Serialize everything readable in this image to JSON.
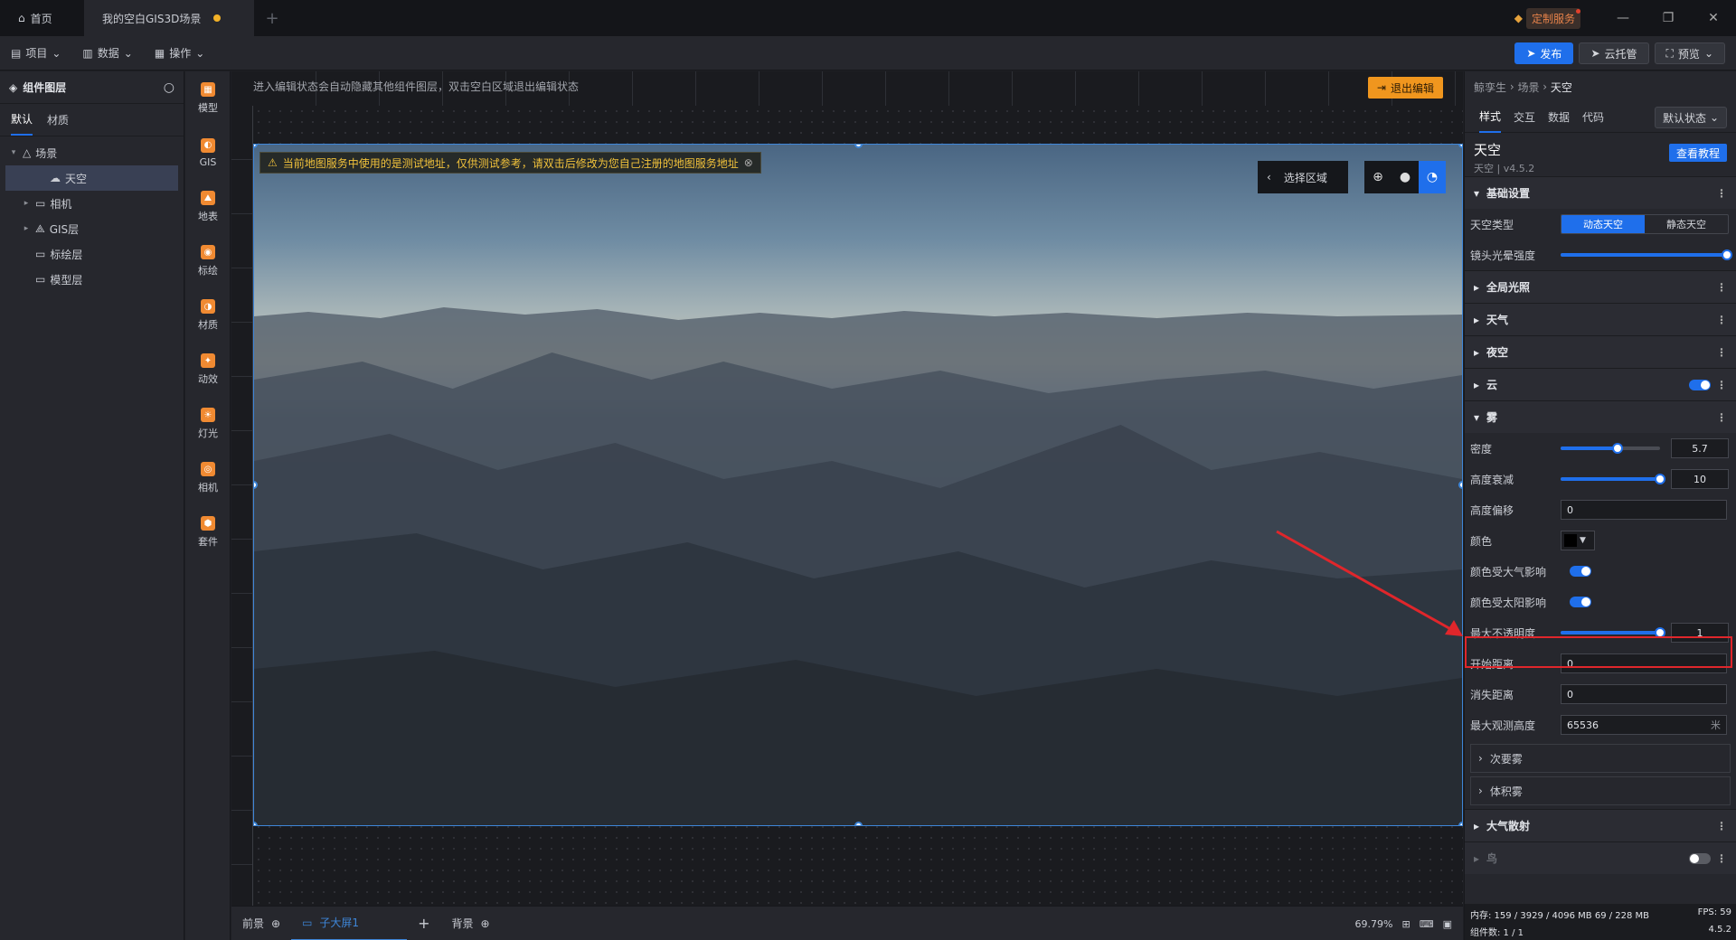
{
  "tabs": {
    "home": "首页",
    "scene_tab": "我的空白GIS3D场景"
  },
  "custom_service": "定制服务",
  "menu": {
    "project": "项目",
    "data": "数据",
    "operate": "操作"
  },
  "actions": {
    "publish": "发布",
    "cloud": "云托管",
    "preview": "预览"
  },
  "left": {
    "title": "组件图层",
    "tab_default": "默认",
    "tab_material": "材质",
    "tree": [
      {
        "label": "场景",
        "caret": "▾",
        "icon": "scene-icon",
        "indent": 0
      },
      {
        "label": "天空",
        "caret": "",
        "icon": "sky-icon",
        "indent": 1,
        "selected": true
      },
      {
        "label": "相机",
        "caret": "▸",
        "icon": "folder-icon",
        "indent": 1
      },
      {
        "label": "GIS层",
        "caret": "▸",
        "icon": "gis-icon",
        "indent": 1
      },
      {
        "label": "标绘层",
        "caret": "",
        "icon": "folder-icon",
        "indent": 1
      },
      {
        "label": "模型层",
        "caret": "",
        "icon": "folder-icon",
        "indent": 1
      }
    ]
  },
  "tools": [
    "模型",
    "GIS",
    "地表",
    "标绘",
    "材质",
    "动效",
    "灯光",
    "相机",
    "套件"
  ],
  "canvas": {
    "hint": "进入编辑状态会自动隐藏其他组件图层，双击空白区域退出编辑状态",
    "exit_edit": "退出编辑",
    "warning": "当前地图服务中使用的是测试地址，仅供测试参考，请双击后修改为您自己注册的地图服务地址",
    "select_region": "选择区域"
  },
  "bottom": {
    "front": "前景",
    "sub_screen": "子大屏1",
    "background": "背景",
    "zoom": "69.79%"
  },
  "right": {
    "breadcrumb": [
      "鲸孪生",
      "场景",
      "天空"
    ],
    "tabs": [
      "样式",
      "交互",
      "数据",
      "代码"
    ],
    "state": "默认状态",
    "comp_name": "天空",
    "comp_version": "天空 | v4.5.2",
    "tutorial": "查看教程",
    "basic": "基础设置",
    "sky_type_label": "天空类型",
    "sky_dynamic": "动态天空",
    "sky_static": "静态天空",
    "lens_flare_label": "镜头光晕强度",
    "lens_flare_value": 1.0,
    "sections": [
      "全局光照",
      "天气",
      "夜空",
      "云"
    ],
    "fog": "雾",
    "density_label": "密度",
    "density_value": "5.7",
    "density_level": 0.57,
    "height_falloff_label": "高度衰减",
    "height_falloff_value": "10",
    "height_falloff_level": 1.0,
    "height_offset_label": "高度偏移",
    "height_offset_value": "0",
    "color_label": "颜色",
    "color_value": "#000000",
    "color_by_atmos_label": "颜色受大气影响",
    "color_by_sun_label": "颜色受太阳影响",
    "max_opacity_label": "最大不透明度",
    "max_opacity_value": "1",
    "max_opacity_level": 1.0,
    "start_dist_label": "开始距离",
    "start_dist_value": "0",
    "fade_dist_label": "消失距离",
    "fade_dist_value": "0",
    "max_obs_label": "最大观测高度",
    "max_obs_value": "65536",
    "max_obs_unit": "米",
    "secondary_fog": "次要雾",
    "volume_fog": "体积雾",
    "atmos": "大气散射",
    "birds": "鸟",
    "status_mem": "内存: 159 / 3929 / 4096 MB  69 / 228 MB",
    "status_fps": "FPS: 59",
    "status_count": "组件数: 1 / 1",
    "status_ver": "4.5.2"
  }
}
